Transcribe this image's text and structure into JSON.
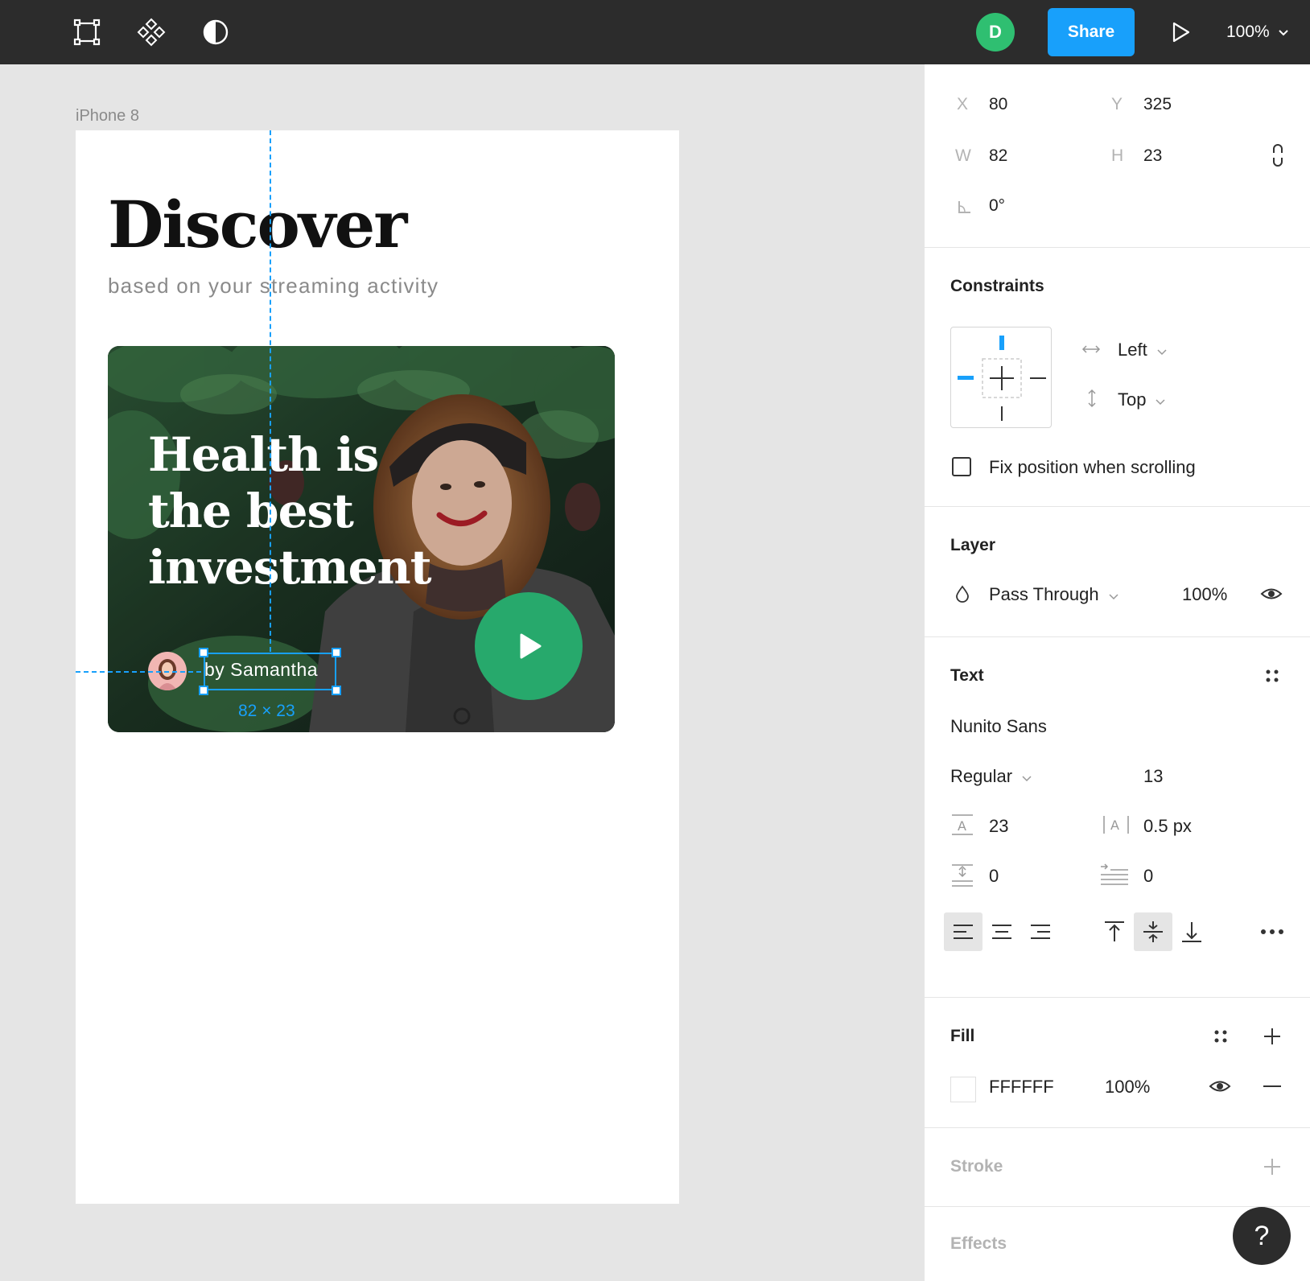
{
  "topbar": {
    "tools": [
      "frame-icon",
      "component-icon",
      "contrast-icon"
    ],
    "user_initial": "D",
    "share_label": "Share",
    "zoom_label": "100%"
  },
  "canvas": {
    "frame_label": "iPhone 8",
    "title": "Discover",
    "subtitle": "based on your streaming activity",
    "card": {
      "headline": "Health is\nthe best\ninvestment",
      "author": "by Samantha"
    },
    "selection_dims": "82 × 23"
  },
  "panel": {
    "position": {
      "x_label": "X",
      "x_value": "80",
      "y_label": "Y",
      "y_value": "325",
      "w_label": "W",
      "w_value": "82",
      "h_label": "H",
      "h_value": "23",
      "rotation_value": "0°"
    },
    "constraints": {
      "title": "Constraints",
      "horizontal": "Left",
      "vertical": "Top",
      "fix_position_label": "Fix position when scrolling"
    },
    "layer": {
      "title": "Layer",
      "blend_mode": "Pass Through",
      "opacity": "100%"
    },
    "text": {
      "title": "Text",
      "font_family": "Nunito Sans",
      "font_style": "Regular",
      "font_size": "13",
      "line_height": "23",
      "letter_spacing": "0.5 px",
      "paragraph_spacing": "0",
      "paragraph_indent": "0"
    },
    "fill": {
      "title": "Fill",
      "hex": "FFFFFF",
      "opacity": "100%"
    },
    "stroke": {
      "title": "Stroke"
    },
    "effects": {
      "title": "Effects"
    }
  },
  "help_label": "?",
  "colors": {
    "accent": "#18a0fb",
    "play_green": "#27a96c",
    "avatar_green": "#2fbf71",
    "topbar": "#2c2c2c"
  }
}
